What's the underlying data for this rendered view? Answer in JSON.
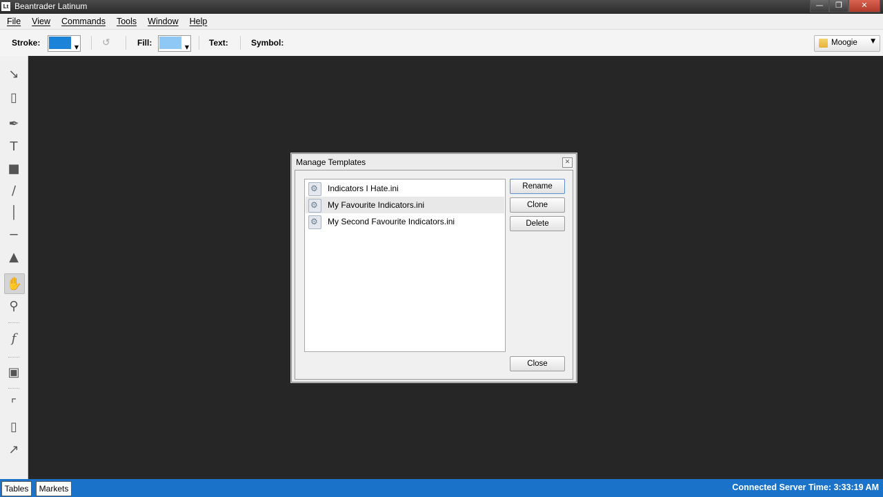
{
  "window": {
    "title": "Beantrader Latinum",
    "app_icon": "Lt",
    "minimize_icon": "minimize-icon",
    "maximize_icon": "restore-icon",
    "close_icon": "close-icon"
  },
  "menu": {
    "items": [
      "File",
      "View",
      "Commands",
      "Tools",
      "Window",
      "Help"
    ]
  },
  "toolbar": {
    "stroke_label": "Stroke:",
    "stroke_color": "#1b84d8",
    "fill_label": "Fill:",
    "fill_color": "#8fc7f5",
    "text_label": "Text:",
    "symbol_label": "Symbol:",
    "workspace": "Moogie"
  },
  "tools": [
    "pointer-icon",
    "eraser-icon",
    "pen-icon",
    "text-tool-icon",
    "rectangle-icon",
    "line-icon",
    "vertical-line-icon",
    "horizontal-line-icon",
    "stamp-icon",
    "hand-icon",
    "zoom-icon",
    "function-icon",
    "panel-icon",
    "chart-type-icon",
    "bar-chart-icon",
    "line-chart-icon"
  ],
  "dialog": {
    "title": "Manage Templates",
    "files": [
      "Indicators I Hate.ini",
      "My Favourite Indicators.ini",
      "My Second Favourite Indicators.ini"
    ],
    "selected_index": 1,
    "buttons": {
      "rename": "Rename",
      "clone": "Clone",
      "delete": "Delete",
      "close": "Close"
    }
  },
  "status": {
    "tabs": [
      "Tables",
      "Markets"
    ],
    "text": "Connected  Server Time: 3:33:19 AM"
  }
}
